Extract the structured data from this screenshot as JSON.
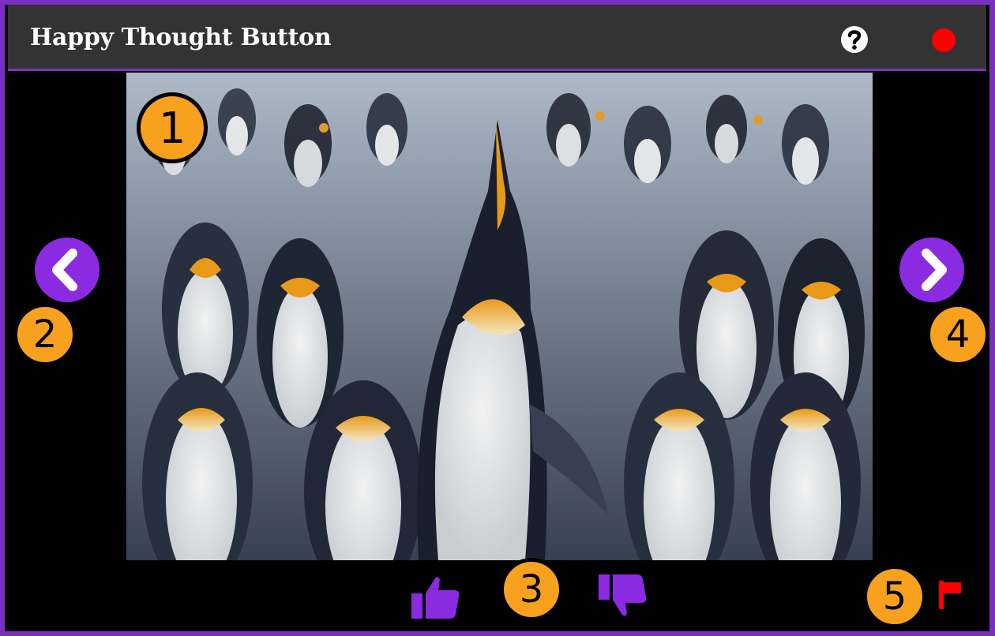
{
  "header": {
    "title": "Happy Thought Button",
    "help_icon": "question-circle-icon",
    "record_icon": "red-dot-icon"
  },
  "photo": {
    "subject": "king-penguin-colony"
  },
  "navigation": {
    "prev_icon": "chevron-left-icon",
    "next_icon": "chevron-right-icon",
    "button_color": "#8a2be2"
  },
  "feedback": {
    "like_icon": "thumbs-up-icon",
    "dislike_icon": "thumbs-down-icon",
    "report_icon": "flag-icon",
    "icon_color": "#8a2be2",
    "flag_color": "#ff0000"
  },
  "callouts": [
    "1",
    "2",
    "3",
    "4",
    "5"
  ],
  "colors": {
    "accent": "#7b2fbf",
    "badge": "#f7a11f",
    "header_bg": "#333333"
  }
}
